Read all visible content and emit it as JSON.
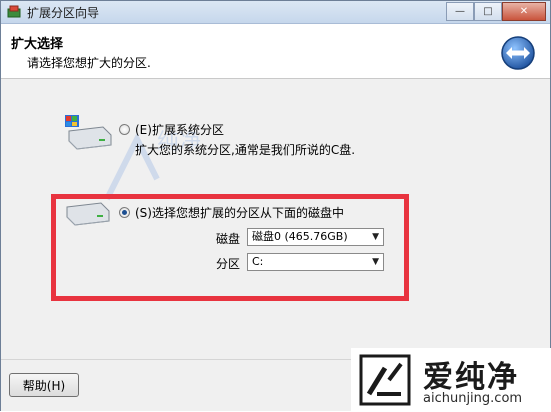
{
  "window": {
    "title": "扩展分区向导",
    "controls": {
      "minimize": "—",
      "maximize": "□",
      "close": "✕"
    }
  },
  "header": {
    "title": "扩大选择",
    "subtitle": "请选择您想扩大的分区.",
    "icon": "expand-arrows-icon"
  },
  "options": [
    {
      "label": "(E)扩展系统分区",
      "description": "扩大您的系统分区,通常是我们所说的C盘.",
      "selected": false,
      "icon": "system-drive-icon"
    },
    {
      "label": "(S)选择您想扩展的分区从下面的磁盘中",
      "selected": true,
      "icon": "drive-icon",
      "disk_label": "磁盘",
      "disk_value": "磁盘0 (465.76GB)",
      "partition_label": "分区",
      "partition_value": "C:"
    }
  ],
  "footer": {
    "help_label": "帮助(H)"
  },
  "watermark": {
    "text": "爱纯净",
    "url": "aichunjing.com"
  },
  "colors": {
    "highlight_box": "#e8333f",
    "title_bar": "#c6d7ec"
  }
}
